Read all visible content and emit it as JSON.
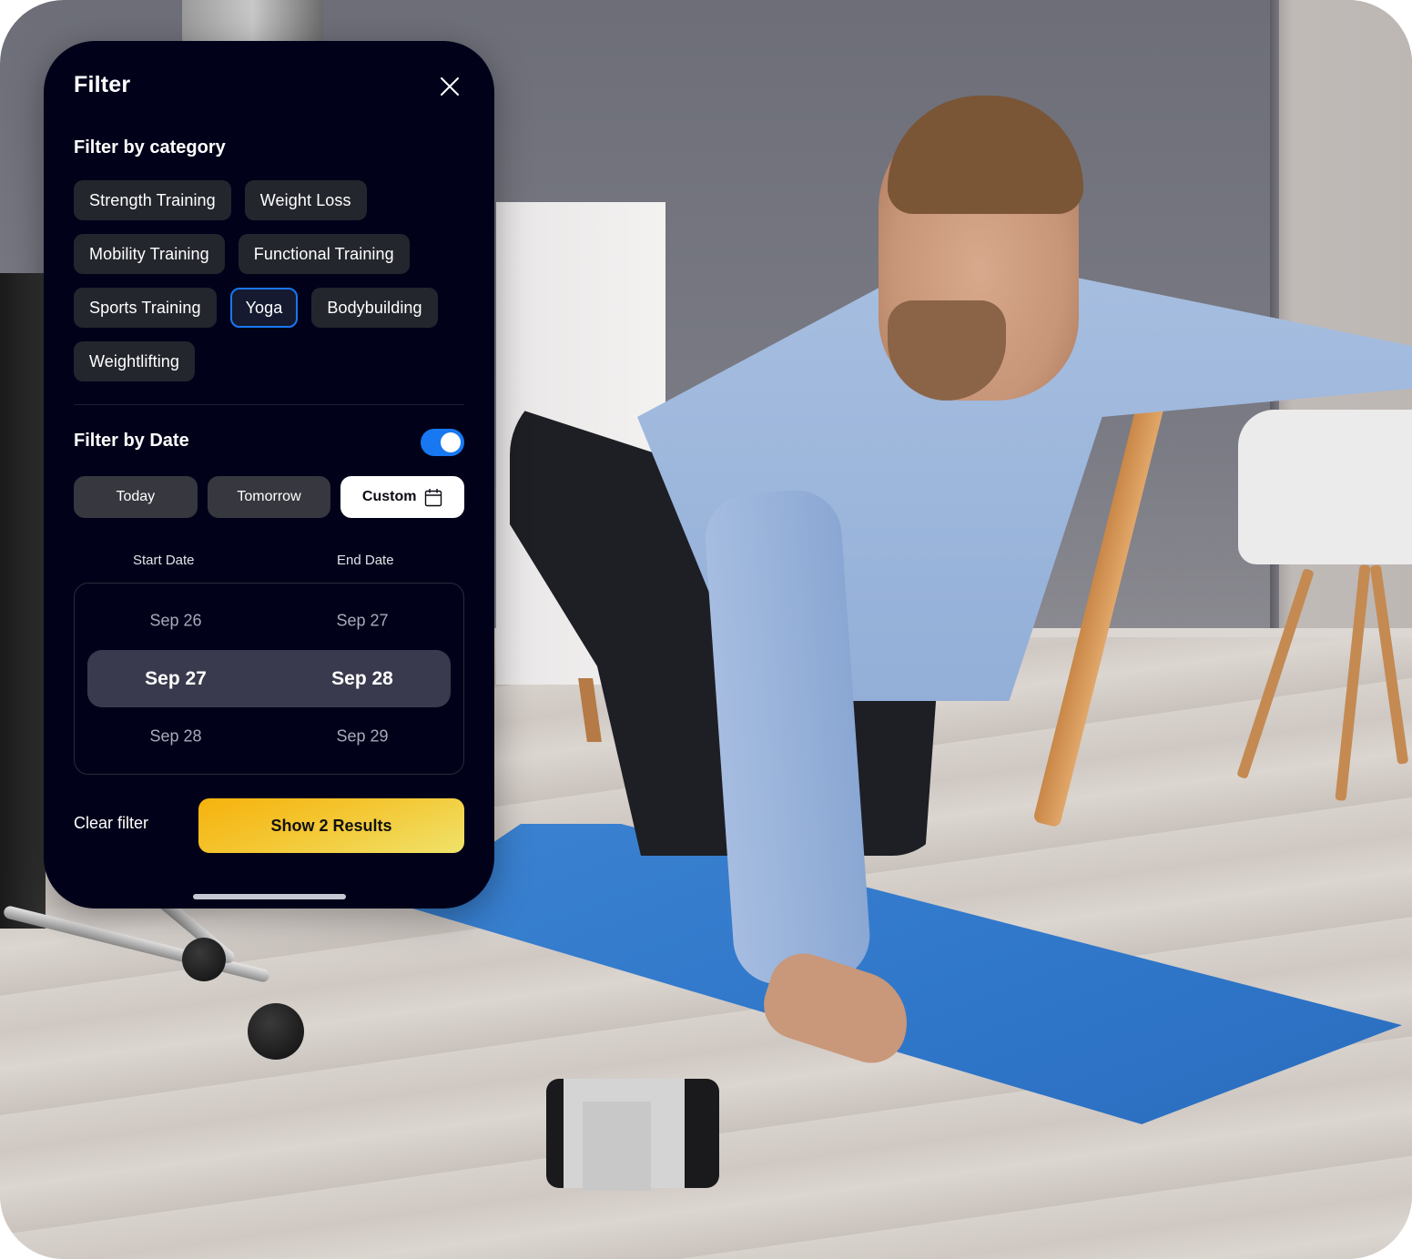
{
  "panel": {
    "title": "Filter",
    "close_icon": "close-icon"
  },
  "category": {
    "title": "Filter by category",
    "chips": [
      {
        "label": "Strength Training",
        "selected": false
      },
      {
        "label": "Weight Loss",
        "selected": false
      },
      {
        "label": "Mobility Training",
        "selected": false
      },
      {
        "label": "Functional Training",
        "selected": false
      },
      {
        "label": "Sports Training",
        "selected": false
      },
      {
        "label": "Yoga",
        "selected": true
      },
      {
        "label": "Bodybuilding",
        "selected": false
      },
      {
        "label": "Weightlifting",
        "selected": false
      }
    ]
  },
  "date": {
    "title": "Filter by Date",
    "toggle_on": true,
    "buttons": [
      {
        "label": "Today",
        "active": false
      },
      {
        "label": "Tomorrow",
        "active": false
      },
      {
        "label": "Custom",
        "active": true,
        "icon": "calendar-icon"
      }
    ],
    "start_label": "Start Date",
    "end_label": "End Date",
    "picker": {
      "above": {
        "start": "Sep 26",
        "end": "Sep 27"
      },
      "selected": {
        "start": "Sep 27",
        "end": "Sep 28"
      },
      "below": {
        "start": "Sep 28",
        "end": "Sep 29"
      }
    }
  },
  "footer": {
    "clear_label": "Clear filter",
    "results_label": "Show 2 Results"
  },
  "colors": {
    "panel_bg": "#01021a",
    "chip_bg": "#24262d",
    "selected_border": "#1876f2",
    "toggle_on": "#1778f2",
    "cta_gradient_start": "#f6b20c",
    "cta_gradient_end": "#f0e26a"
  }
}
